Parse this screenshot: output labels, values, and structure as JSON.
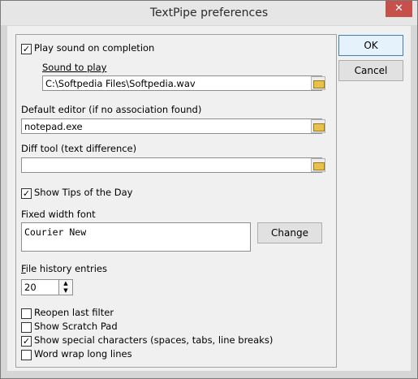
{
  "window": {
    "title": "TextPipe preferences",
    "close_glyph": "✕"
  },
  "buttons": {
    "ok": "OK",
    "cancel": "Cancel",
    "change": "Change"
  },
  "play_sound": {
    "label": "Play sound on completion",
    "checked": true
  },
  "sound": {
    "label": "Sound to play",
    "value": "C:\\Softpedia Files\\Softpedia.wav"
  },
  "editor": {
    "label": "Default editor (if no association found)",
    "value": "notepad.exe"
  },
  "diff": {
    "label": "Diff tool (text difference)",
    "value": ""
  },
  "tips": {
    "label": "Show Tips of the Day",
    "checked": true
  },
  "font": {
    "label": "Fixed width font",
    "value": "Courier New"
  },
  "history": {
    "label": "File history entries",
    "value": "20"
  },
  "options": [
    {
      "label": "Reopen last filter",
      "checked": false
    },
    {
      "label": "Show Scratch Pad",
      "checked": false
    },
    {
      "label": "Show special characters (spaces, tabs, line breaks)",
      "checked": true
    },
    {
      "label": "Word wrap long lines",
      "checked": false
    }
  ],
  "check_glyph": "✓",
  "icons": {
    "browse": "folder-open-icon",
    "spin": "spin-arrows-icon",
    "close": "close-icon"
  }
}
